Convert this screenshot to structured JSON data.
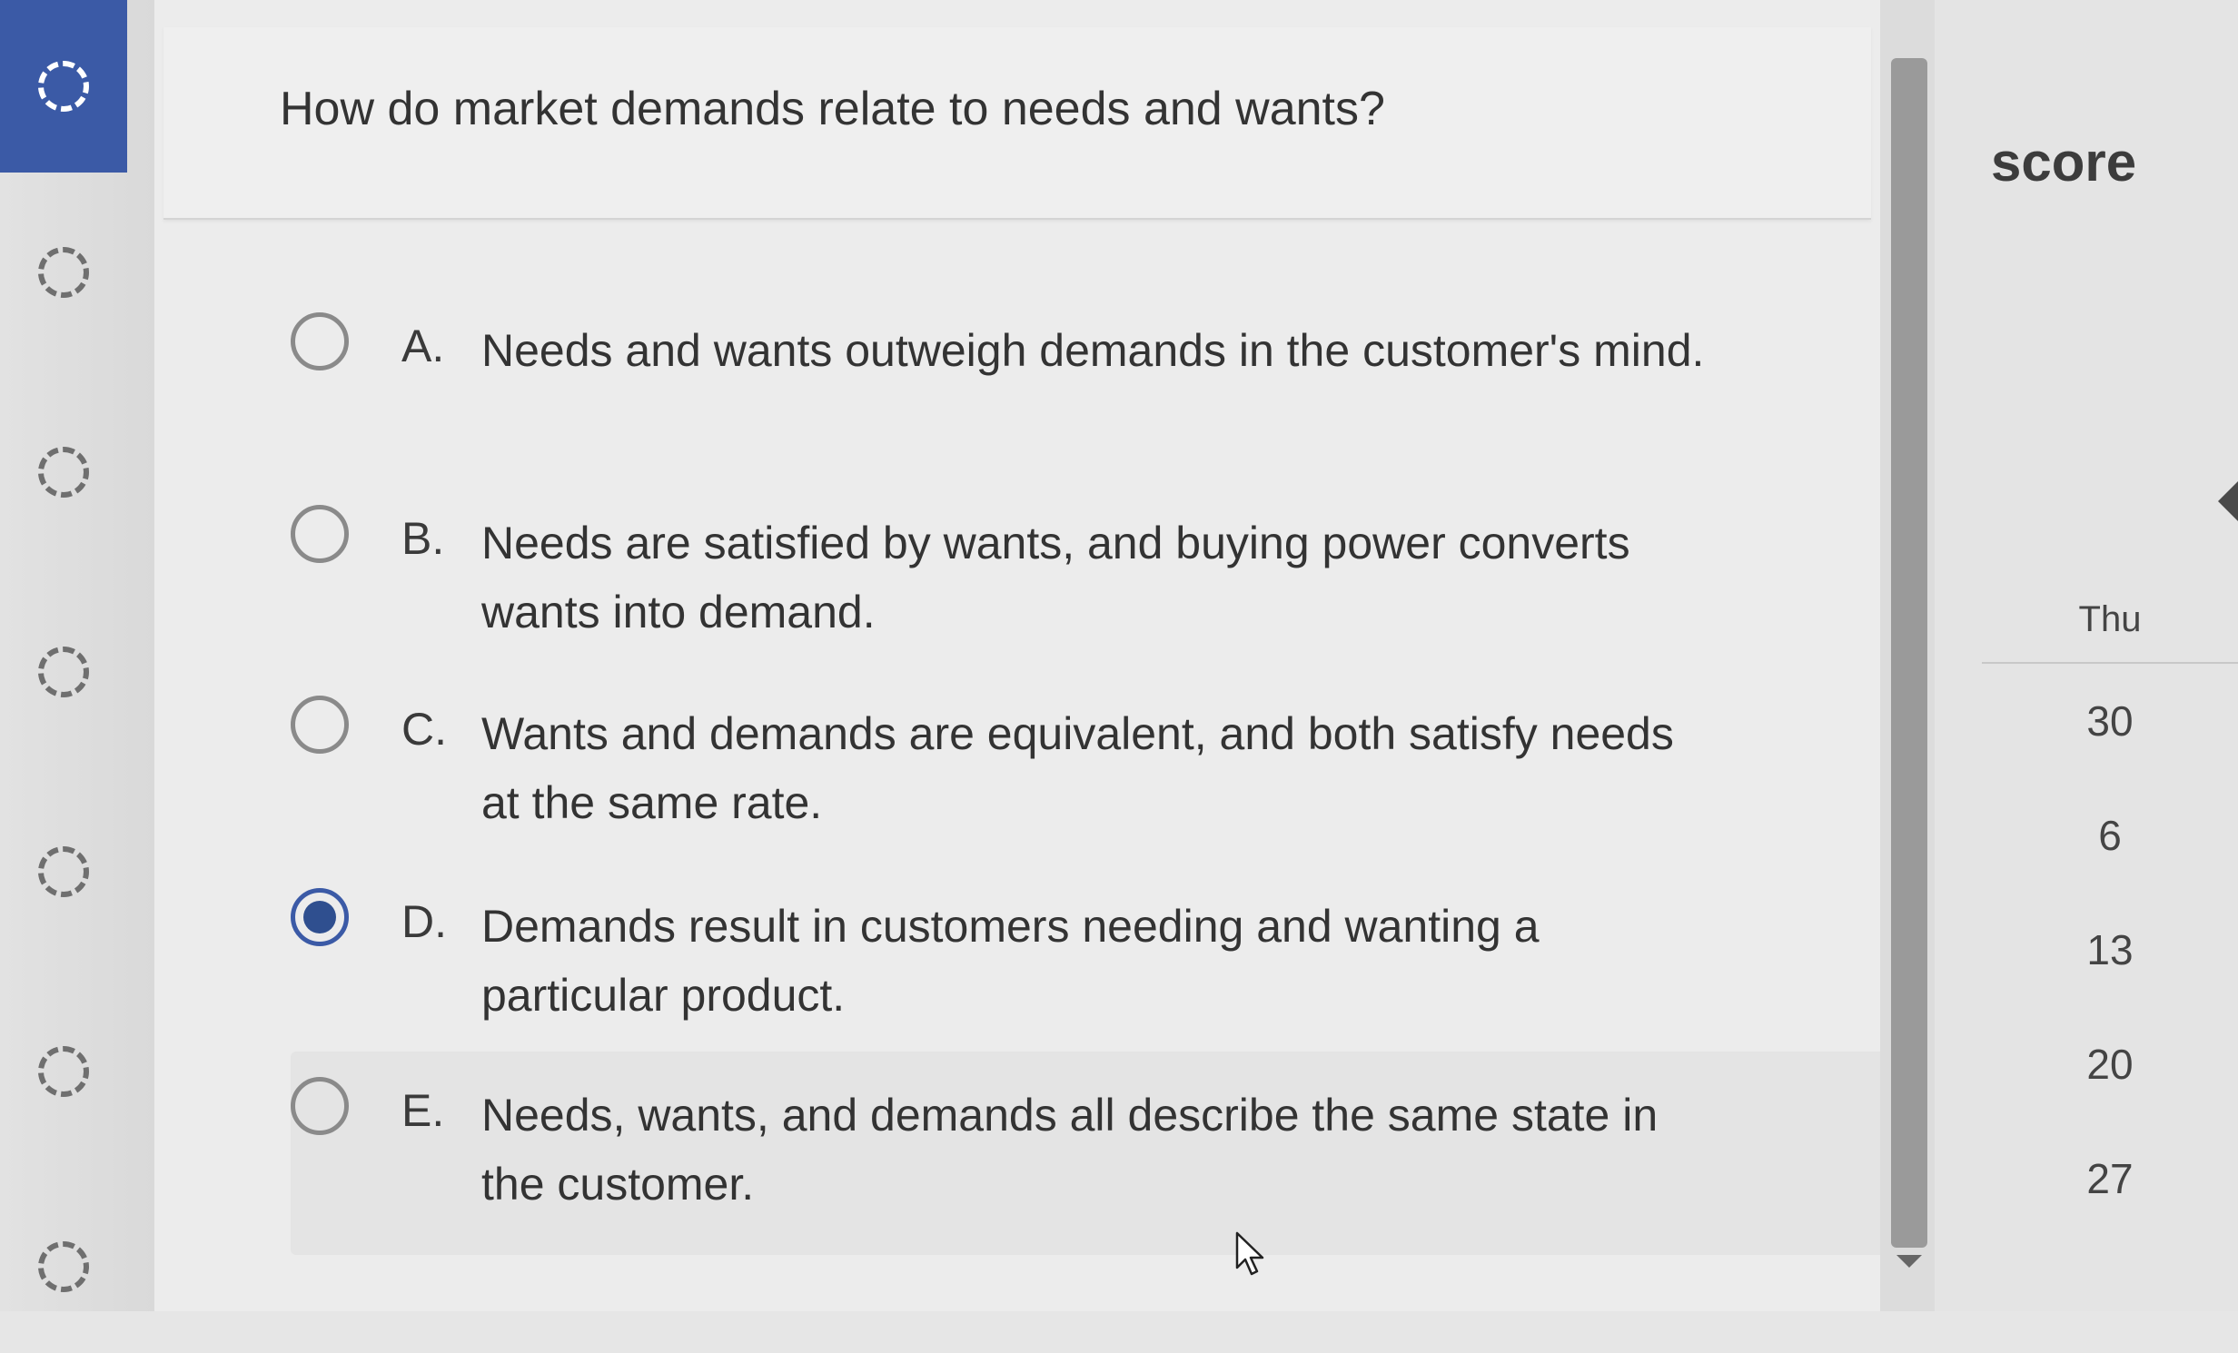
{
  "question": {
    "text": "How do market demands relate to needs and wants?"
  },
  "answers": [
    {
      "letter": "A.",
      "text": "Needs and wants outweigh demands in the customer's mind.",
      "selected": false
    },
    {
      "letter": "B.",
      "text": "Needs are satisfied by wants, and buying power converts wants into demand.",
      "selected": false
    },
    {
      "letter": "C.",
      "text": "Wants and demands are equivalent, and both satisfy needs at the same rate.",
      "selected": false
    },
    {
      "letter": "D.",
      "text": "Demands result in customers needing and wanting a particular product.",
      "selected": true
    },
    {
      "letter": "E.",
      "text": "Needs, wants, and demands all describe the same state in the customer.",
      "selected": false
    }
  ],
  "sidebar": {
    "score_label": "score",
    "calendar": {
      "weekday": "Thu",
      "days": [
        "30",
        "6",
        "13",
        "20",
        "27"
      ]
    }
  },
  "colors": {
    "accent": "#3b5aa6",
    "selected_radio": "#2f4f8f"
  }
}
